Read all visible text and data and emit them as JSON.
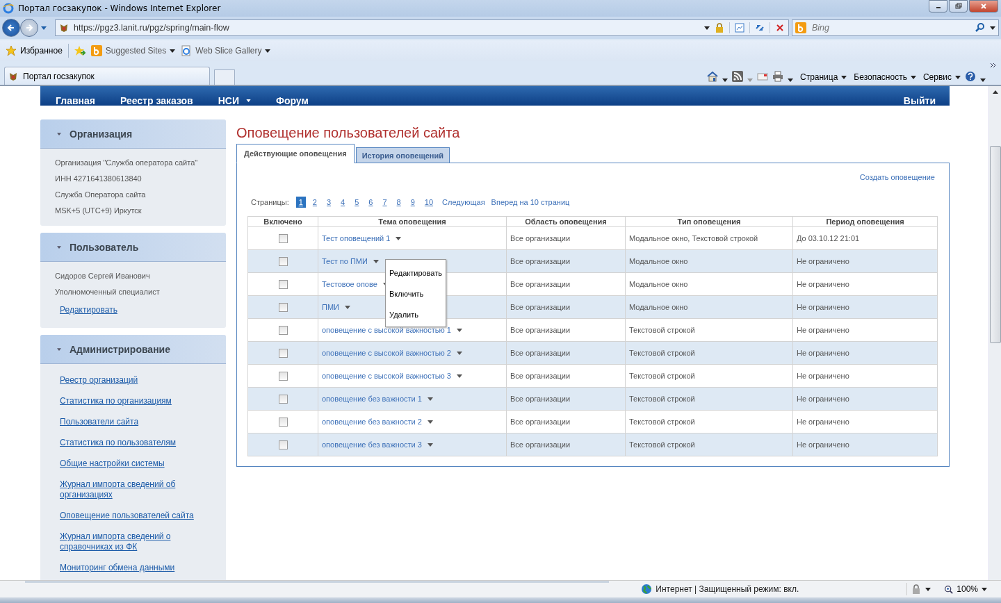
{
  "browser": {
    "title": "Портал госзакупок - Windows Internet Explorer",
    "address": "https://pgz3.lanit.ru/pgz/spring/main-flow",
    "search_placeholder": "Bing",
    "favorites": "Избранное",
    "favorite_links": [
      {
        "label": "Suggested Sites"
      },
      {
        "label": "Web Slice Gallery"
      }
    ],
    "tabs": [
      {
        "label": "Портал госзакупок",
        "selected": true
      }
    ],
    "command_menus": [
      "Страница",
      "Безопасность",
      "Сервис"
    ],
    "status": "Интернет | Защищенный режим: вкл.",
    "zoom": "100%"
  },
  "nav": {
    "items": [
      {
        "label": "Главная",
        "dropdown": false
      },
      {
        "label": "Реестр заказов",
        "dropdown": false
      },
      {
        "label": "НСИ",
        "dropdown": true
      },
      {
        "label": "Форум",
        "dropdown": false
      }
    ],
    "logout": "Выйти"
  },
  "sidebar": [
    {
      "title": "Организация",
      "expanded": true,
      "items": [
        {
          "kind": "text",
          "label": "Организация \"Служба оператора сайта\""
        },
        {
          "kind": "text",
          "label": "ИНН 4271641380613840"
        },
        {
          "kind": "text",
          "label": "Служба Оператора сайта"
        },
        {
          "kind": "text",
          "label": "MSK+5 (UTC+9) Иркутск"
        }
      ]
    },
    {
      "title": "Пользователь",
      "expanded": true,
      "items": [
        {
          "kind": "text",
          "label": "Сидоров Сергей Иванович"
        },
        {
          "kind": "text",
          "label": "Уполномоченный специалист"
        },
        {
          "kind": "link",
          "label": "Редактировать"
        }
      ]
    },
    {
      "title": "Администрирование",
      "expanded": true,
      "items": [
        {
          "kind": "link",
          "label": "Реестр организаций"
        },
        {
          "kind": "link",
          "label": "Статистика по организациям"
        },
        {
          "kind": "link",
          "label": "Пользователи сайта"
        },
        {
          "kind": "link",
          "label": "Статистика по пользователям"
        },
        {
          "kind": "link",
          "label": "Общие настройки системы"
        },
        {
          "kind": "link",
          "label": "Журнал импорта сведений об организациях"
        },
        {
          "kind": "link",
          "label": "Оповещение пользователей сайта"
        },
        {
          "kind": "link",
          "label": "Журнал импорта сведений о справочниках из ФК"
        },
        {
          "kind": "link",
          "label": "Мониторинг обмена данными"
        }
      ]
    }
  ],
  "main": {
    "title": "Оповещение пользователей сайта",
    "tabs": [
      {
        "label": "Действующие оповещения",
        "selected": true
      },
      {
        "label": "История оповещений",
        "selected": false
      }
    ],
    "create_link": "Создать оповещение",
    "pager": {
      "label": "Страницы:",
      "pages": [
        {
          "label": "1",
          "selected": true
        },
        {
          "label": "2",
          "selected": false
        },
        {
          "label": "3",
          "selected": false
        },
        {
          "label": "4",
          "selected": false
        },
        {
          "label": "5",
          "selected": false
        },
        {
          "label": "6",
          "selected": false
        },
        {
          "label": "7",
          "selected": false
        },
        {
          "label": "8",
          "selected": false
        },
        {
          "label": "9",
          "selected": false
        },
        {
          "label": "10",
          "selected": false
        }
      ],
      "next": "Следующая",
      "forward": "Вперед на 10 страниц"
    },
    "table": {
      "columns": [
        "Включено",
        "Тема оповещения",
        "Область оповещения",
        "Тип оповещения",
        "Период оповещения"
      ],
      "rows": [
        {
          "enabled": false,
          "topic": "Тест оповещений 1",
          "area": "Все организации",
          "type": "Модальное окно, Текстовой строкой",
          "period": "До 03.10.12 21:01"
        },
        {
          "enabled": false,
          "topic": "Тест по ПМИ",
          "area": "Все организации",
          "type": "Модальное окно",
          "period": "Не ограничено"
        },
        {
          "enabled": false,
          "topic": "Тестовое опове",
          "area": "Все организации",
          "type": "Модальное окно",
          "period": "Не ограничено"
        },
        {
          "enabled": false,
          "topic": "ПМИ",
          "area": "Все организации",
          "type": "Модальное окно",
          "period": "Не ограничено"
        },
        {
          "enabled": false,
          "topic": "оповещение с высокой важностью 1",
          "area": "Все организации",
          "type": "Текстовой строкой",
          "period": "Не ограничено"
        },
        {
          "enabled": false,
          "topic": "оповещение с высокой важностью 2",
          "area": "Все организации",
          "type": "Текстовой строкой",
          "period": "Не ограничено"
        },
        {
          "enabled": false,
          "topic": "оповещение с высокой важностью 3",
          "area": "Все организации",
          "type": "Текстовой строкой",
          "period": "Не ограничено"
        },
        {
          "enabled": false,
          "topic": "оповещение без важности 1",
          "area": "Все организации",
          "type": "Текстовой строкой",
          "period": "Не ограничено"
        },
        {
          "enabled": false,
          "topic": "оповещение без важности 2",
          "area": "Все организации",
          "type": "Текстовой строкой",
          "period": "Не ограничено"
        },
        {
          "enabled": false,
          "topic": "оповещение без важности 3",
          "area": "Все организации",
          "type": "Текстовой строкой",
          "period": "Не ограничено"
        }
      ]
    },
    "context_menu": {
      "items": [
        "Редактировать",
        "Включить",
        "Удалить"
      ]
    }
  }
}
